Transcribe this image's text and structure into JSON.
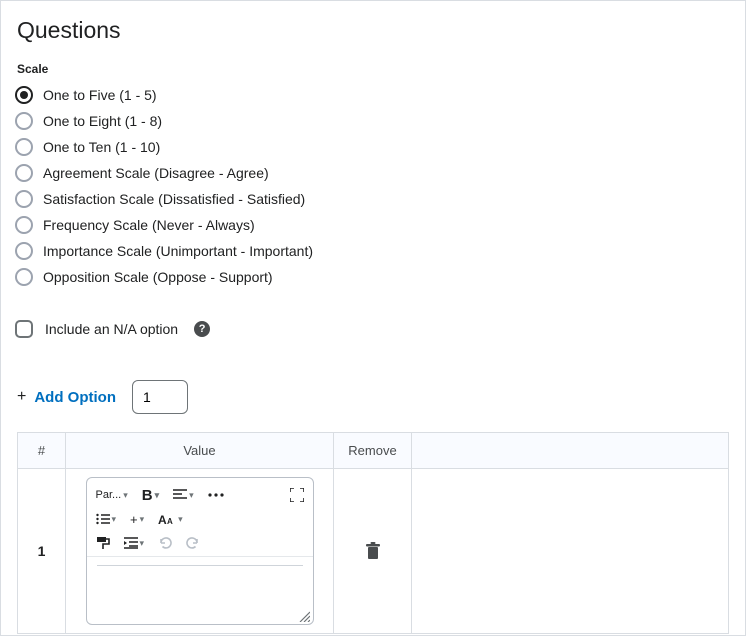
{
  "title": "Questions",
  "scale": {
    "label": "Scale",
    "options": [
      {
        "label": "One to Five (1 - 5)",
        "selected": true
      },
      {
        "label": "One to Eight (1 - 8)",
        "selected": false
      },
      {
        "label": "One to Ten (1 - 10)",
        "selected": false
      },
      {
        "label": "Agreement Scale (Disagree - Agree)",
        "selected": false
      },
      {
        "label": "Satisfaction Scale (Dissatisfied - Satisfied)",
        "selected": false
      },
      {
        "label": "Frequency Scale (Never - Always)",
        "selected": false
      },
      {
        "label": "Importance Scale (Unimportant - Important)",
        "selected": false
      },
      {
        "label": "Opposition Scale (Oppose - Support)",
        "selected": false
      }
    ]
  },
  "na_option": {
    "label": "Include an N/A option",
    "checked": false
  },
  "add_option": {
    "label": "Add Option",
    "count": "1"
  },
  "table": {
    "headers": {
      "num": "#",
      "value": "Value",
      "remove": "Remove"
    },
    "rows": [
      {
        "num": "1",
        "value": ""
      }
    ]
  },
  "editor_toolbar": {
    "paragraph_label": "Par...",
    "bold_label": "B",
    "font_label": "A",
    "plus_label": "+"
  }
}
